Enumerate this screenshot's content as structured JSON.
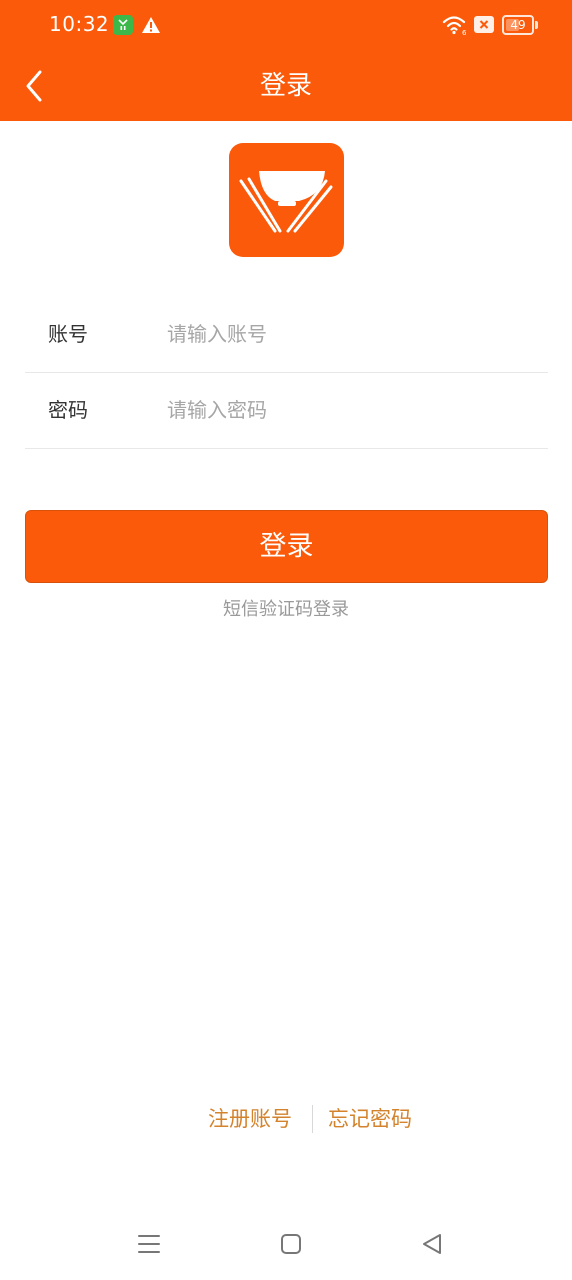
{
  "status_bar": {
    "time": "10:32",
    "battery_level": "49",
    "battery_fraction": 0.49,
    "icons": [
      "app-notification-icon",
      "warning-icon",
      "wifi-icon",
      "x-icon",
      "battery-icon"
    ]
  },
  "header": {
    "title": "登录",
    "back_icon": "chevron-left-icon",
    "background_color": "#fa5a0a"
  },
  "logo": {
    "icon": "rice-bowl-chopsticks-icon"
  },
  "form": {
    "account_label": "账号",
    "account_placeholder": "请输入账号",
    "account_value": "",
    "password_label": "密码",
    "password_placeholder": "请输入密码",
    "password_value": ""
  },
  "actions": {
    "login_label": "登录",
    "sms_login_label": "短信验证码登录"
  },
  "links": {
    "register_label": "注册账号",
    "forgot_label": "忘记密码",
    "color": "#d4832d"
  },
  "nav_bar": {
    "icons": [
      "menu-icon",
      "home-square-icon",
      "back-triangle-icon"
    ]
  }
}
